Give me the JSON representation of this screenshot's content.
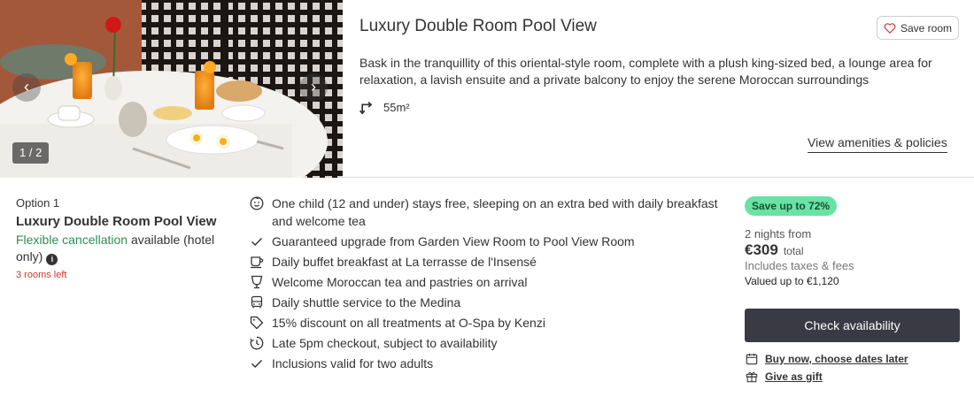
{
  "gallery": {
    "counter": "1 / 2",
    "prev_icon": "chevron-left-icon",
    "next_icon": "chevron-right-icon"
  },
  "room": {
    "title": "Luxury Double Room Pool View",
    "save_label": "Save room",
    "description": "Bask in the tranquillity of this oriental-style room, complete with a plush king-sized bed, a lounge area for relaxation, a lavish ensuite and a private balcony to enjoy the serene Moroccan surroundings",
    "size": "55m²",
    "amenities_link": "View amenities & policies"
  },
  "option": {
    "label": "Option 1",
    "title": "Luxury Double Room Pool View",
    "cancel_highlight": "Flexible cancellation",
    "cancel_rest": " available (hotel only)",
    "rooms_left": "3 rooms left"
  },
  "benefits": [
    {
      "icon": "child-face-icon",
      "text": "One child (12 and under) stays free, sleeping on an extra bed with daily breakfast and welcome tea"
    },
    {
      "icon": "check-icon",
      "text": "Guaranteed upgrade from Garden View Room to Pool View Room"
    },
    {
      "icon": "coffee-cup-icon",
      "text": "Daily buffet breakfast at La terrasse de l'Insensé"
    },
    {
      "icon": "glass-icon",
      "text": "Welcome Moroccan tea and pastries on arrival"
    },
    {
      "icon": "bus-icon",
      "text": "Daily shuttle service to the Medina"
    },
    {
      "icon": "tag-icon",
      "text": "15% discount on all treatments at O-Spa by Kenzi"
    },
    {
      "icon": "clock-icon",
      "text": "Late 5pm checkout, subject to availability"
    },
    {
      "icon": "check-icon",
      "text": "Inclusions valid for two adults"
    }
  ],
  "pricing": {
    "save_badge": "Save up to 72%",
    "nights": "2 nights from",
    "price": "€309",
    "total_label": "total",
    "taxes": "Includes taxes & fees",
    "valued": "Valued up to €1,120",
    "check_button": "Check availability",
    "buy_now": "Buy now, choose dates later",
    "gift": "Give as gift"
  },
  "colors": {
    "accent_green": "#2e8b57",
    "badge_green": "#68e3a4",
    "alert_red": "#c8382c",
    "button_dark": "#3a3a44"
  }
}
